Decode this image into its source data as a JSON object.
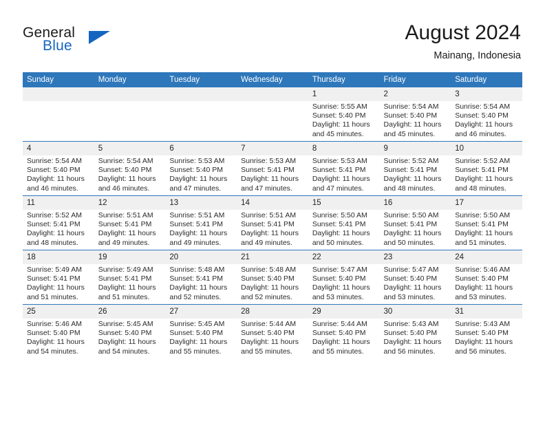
{
  "brand": {
    "name_top": "General",
    "name_bottom": "Blue",
    "accent_color": "#1565c0"
  },
  "header": {
    "month_title": "August 2024",
    "location": "Mainang, Indonesia",
    "header_bg_color": "#2e77bb"
  },
  "weekday_headers": [
    "Sunday",
    "Monday",
    "Tuesday",
    "Wednesday",
    "Thursday",
    "Friday",
    "Saturday"
  ],
  "labels": {
    "sunrise_prefix": "Sunrise: ",
    "sunset_prefix": "Sunset: ",
    "daylight_prefix": "Daylight: "
  },
  "weeks": [
    [
      {
        "day": "",
        "empty": true,
        "sunrise": "",
        "sunset": "",
        "daylight": ""
      },
      {
        "day": "",
        "empty": true,
        "sunrise": "",
        "sunset": "",
        "daylight": ""
      },
      {
        "day": "",
        "empty": true,
        "sunrise": "",
        "sunset": "",
        "daylight": ""
      },
      {
        "day": "",
        "empty": true,
        "sunrise": "",
        "sunset": "",
        "daylight": ""
      },
      {
        "day": "1",
        "empty": false,
        "sunrise": "Sunrise: 5:55 AM",
        "sunset": "Sunset: 5:40 PM",
        "daylight": "Daylight: 11 hours and 45 minutes."
      },
      {
        "day": "2",
        "empty": false,
        "sunrise": "Sunrise: 5:54 AM",
        "sunset": "Sunset: 5:40 PM",
        "daylight": "Daylight: 11 hours and 45 minutes."
      },
      {
        "day": "3",
        "empty": false,
        "sunrise": "Sunrise: 5:54 AM",
        "sunset": "Sunset: 5:40 PM",
        "daylight": "Daylight: 11 hours and 46 minutes."
      }
    ],
    [
      {
        "day": "4",
        "empty": false,
        "sunrise": "Sunrise: 5:54 AM",
        "sunset": "Sunset: 5:40 PM",
        "daylight": "Daylight: 11 hours and 46 minutes."
      },
      {
        "day": "5",
        "empty": false,
        "sunrise": "Sunrise: 5:54 AM",
        "sunset": "Sunset: 5:40 PM",
        "daylight": "Daylight: 11 hours and 46 minutes."
      },
      {
        "day": "6",
        "empty": false,
        "sunrise": "Sunrise: 5:53 AM",
        "sunset": "Sunset: 5:40 PM",
        "daylight": "Daylight: 11 hours and 47 minutes."
      },
      {
        "day": "7",
        "empty": false,
        "sunrise": "Sunrise: 5:53 AM",
        "sunset": "Sunset: 5:41 PM",
        "daylight": "Daylight: 11 hours and 47 minutes."
      },
      {
        "day": "8",
        "empty": false,
        "sunrise": "Sunrise: 5:53 AM",
        "sunset": "Sunset: 5:41 PM",
        "daylight": "Daylight: 11 hours and 47 minutes."
      },
      {
        "day": "9",
        "empty": false,
        "sunrise": "Sunrise: 5:52 AM",
        "sunset": "Sunset: 5:41 PM",
        "daylight": "Daylight: 11 hours and 48 minutes."
      },
      {
        "day": "10",
        "empty": false,
        "sunrise": "Sunrise: 5:52 AM",
        "sunset": "Sunset: 5:41 PM",
        "daylight": "Daylight: 11 hours and 48 minutes."
      }
    ],
    [
      {
        "day": "11",
        "empty": false,
        "sunrise": "Sunrise: 5:52 AM",
        "sunset": "Sunset: 5:41 PM",
        "daylight": "Daylight: 11 hours and 48 minutes."
      },
      {
        "day": "12",
        "empty": false,
        "sunrise": "Sunrise: 5:51 AM",
        "sunset": "Sunset: 5:41 PM",
        "daylight": "Daylight: 11 hours and 49 minutes."
      },
      {
        "day": "13",
        "empty": false,
        "sunrise": "Sunrise: 5:51 AM",
        "sunset": "Sunset: 5:41 PM",
        "daylight": "Daylight: 11 hours and 49 minutes."
      },
      {
        "day": "14",
        "empty": false,
        "sunrise": "Sunrise: 5:51 AM",
        "sunset": "Sunset: 5:41 PM",
        "daylight": "Daylight: 11 hours and 49 minutes."
      },
      {
        "day": "15",
        "empty": false,
        "sunrise": "Sunrise: 5:50 AM",
        "sunset": "Sunset: 5:41 PM",
        "daylight": "Daylight: 11 hours and 50 minutes."
      },
      {
        "day": "16",
        "empty": false,
        "sunrise": "Sunrise: 5:50 AM",
        "sunset": "Sunset: 5:41 PM",
        "daylight": "Daylight: 11 hours and 50 minutes."
      },
      {
        "day": "17",
        "empty": false,
        "sunrise": "Sunrise: 5:50 AM",
        "sunset": "Sunset: 5:41 PM",
        "daylight": "Daylight: 11 hours and 51 minutes."
      }
    ],
    [
      {
        "day": "18",
        "empty": false,
        "sunrise": "Sunrise: 5:49 AM",
        "sunset": "Sunset: 5:41 PM",
        "daylight": "Daylight: 11 hours and 51 minutes."
      },
      {
        "day": "19",
        "empty": false,
        "sunrise": "Sunrise: 5:49 AM",
        "sunset": "Sunset: 5:41 PM",
        "daylight": "Daylight: 11 hours and 51 minutes."
      },
      {
        "day": "20",
        "empty": false,
        "sunrise": "Sunrise: 5:48 AM",
        "sunset": "Sunset: 5:41 PM",
        "daylight": "Daylight: 11 hours and 52 minutes."
      },
      {
        "day": "21",
        "empty": false,
        "sunrise": "Sunrise: 5:48 AM",
        "sunset": "Sunset: 5:40 PM",
        "daylight": "Daylight: 11 hours and 52 minutes."
      },
      {
        "day": "22",
        "empty": false,
        "sunrise": "Sunrise: 5:47 AM",
        "sunset": "Sunset: 5:40 PM",
        "daylight": "Daylight: 11 hours and 53 minutes."
      },
      {
        "day": "23",
        "empty": false,
        "sunrise": "Sunrise: 5:47 AM",
        "sunset": "Sunset: 5:40 PM",
        "daylight": "Daylight: 11 hours and 53 minutes."
      },
      {
        "day": "24",
        "empty": false,
        "sunrise": "Sunrise: 5:46 AM",
        "sunset": "Sunset: 5:40 PM",
        "daylight": "Daylight: 11 hours and 53 minutes."
      }
    ],
    [
      {
        "day": "25",
        "empty": false,
        "sunrise": "Sunrise: 5:46 AM",
        "sunset": "Sunset: 5:40 PM",
        "daylight": "Daylight: 11 hours and 54 minutes."
      },
      {
        "day": "26",
        "empty": false,
        "sunrise": "Sunrise: 5:45 AM",
        "sunset": "Sunset: 5:40 PM",
        "daylight": "Daylight: 11 hours and 54 minutes."
      },
      {
        "day": "27",
        "empty": false,
        "sunrise": "Sunrise: 5:45 AM",
        "sunset": "Sunset: 5:40 PM",
        "daylight": "Daylight: 11 hours and 55 minutes."
      },
      {
        "day": "28",
        "empty": false,
        "sunrise": "Sunrise: 5:44 AM",
        "sunset": "Sunset: 5:40 PM",
        "daylight": "Daylight: 11 hours and 55 minutes."
      },
      {
        "day": "29",
        "empty": false,
        "sunrise": "Sunrise: 5:44 AM",
        "sunset": "Sunset: 5:40 PM",
        "daylight": "Daylight: 11 hours and 55 minutes."
      },
      {
        "day": "30",
        "empty": false,
        "sunrise": "Sunrise: 5:43 AM",
        "sunset": "Sunset: 5:40 PM",
        "daylight": "Daylight: 11 hours and 56 minutes."
      },
      {
        "day": "31",
        "empty": false,
        "sunrise": "Sunrise: 5:43 AM",
        "sunset": "Sunset: 5:40 PM",
        "daylight": "Daylight: 11 hours and 56 minutes."
      }
    ]
  ]
}
